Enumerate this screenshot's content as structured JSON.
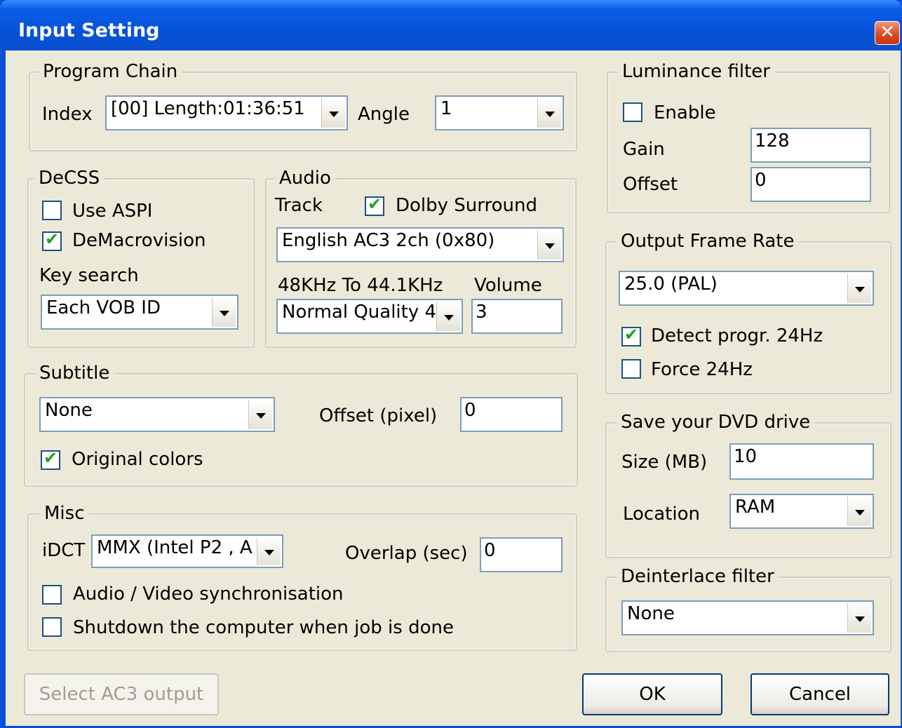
{
  "window": {
    "title": "Input Setting",
    "close_glyph": "✕"
  },
  "program_chain": {
    "title": "Program Chain",
    "index_label": "Index",
    "index_value": "[00] Length:01:36:51",
    "angle_label": "Angle",
    "angle_value": "1"
  },
  "decss": {
    "title": "DeCSS",
    "use_aspi_label": "Use ASPI",
    "use_aspi_checked": false,
    "demacrovision_label": "DeMacrovision",
    "demacrovision_checked": true,
    "key_search_label": "Key search",
    "key_search_value": "Each VOB ID"
  },
  "audio": {
    "title": "Audio",
    "track_label": "Track",
    "dolby_label": "Dolby Surround",
    "dolby_checked": true,
    "track_value": "English AC3 2ch (0x80)",
    "resample_label": "48KHz To 44.1KHz",
    "volume_label": "Volume",
    "resample_value": "Normal Quality 4",
    "volume_value": "3"
  },
  "subtitle": {
    "title": "Subtitle",
    "subtitle_value": "None",
    "offset_label": "Offset (pixel)",
    "offset_value": "0",
    "original_colors_label": "Original colors",
    "original_colors_checked": true
  },
  "misc": {
    "title": "Misc",
    "idct_label": "iDCT",
    "idct_value": "MMX (Intel P2 , A",
    "overlap_label": "Overlap (sec)",
    "overlap_value": "0",
    "av_sync_label": "Audio / Video synchronisation",
    "av_sync_checked": false,
    "shutdown_label": "Shutdown the computer when job is done",
    "shutdown_checked": false
  },
  "luminance": {
    "title": "Luminance filter",
    "enable_label": "Enable",
    "enable_checked": false,
    "gain_label": "Gain",
    "gain_value": "128",
    "offset_label": "Offset",
    "offset_value": "0"
  },
  "frame_rate": {
    "title": "Output Frame Rate",
    "value": "25.0  (PAL)",
    "detect_label": "Detect progr. 24Hz",
    "detect_checked": true,
    "force_label": "Force 24Hz",
    "force_checked": false
  },
  "dvd_drive": {
    "title": "Save your DVD drive",
    "size_label": "Size (MB)",
    "size_value": "10",
    "location_label": "Location",
    "location_value": "RAM"
  },
  "deinterlace": {
    "title": "Deinterlace filter",
    "value": "None"
  },
  "buttons": {
    "select_ac3": "Select AC3 output",
    "ok": "OK",
    "cancel": "Cancel"
  },
  "colors": {
    "title_bar": "#0652d8",
    "dialog_bg": "#ece9d8",
    "close_button": "#d9471f",
    "checkmark": "#21a121"
  }
}
